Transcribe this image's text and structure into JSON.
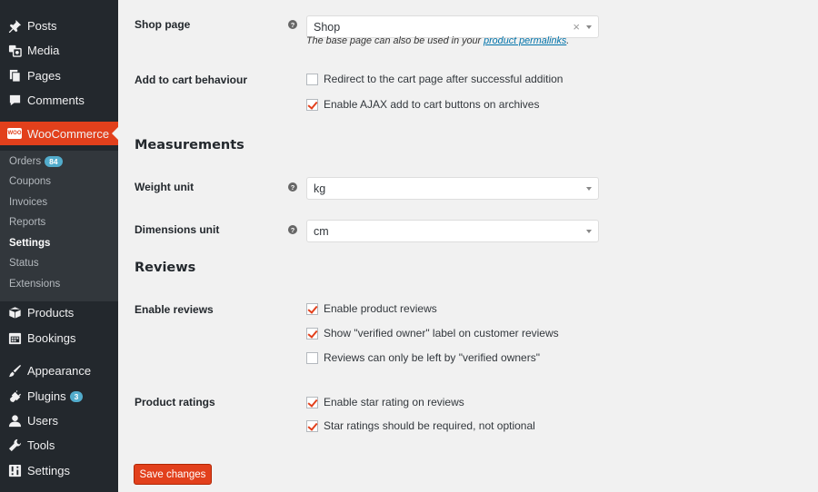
{
  "sidebar": {
    "items": [
      {
        "label": "Posts",
        "icon": "pin-icon"
      },
      {
        "label": "Media",
        "icon": "media-icon"
      },
      {
        "label": "Pages",
        "icon": "pages-icon"
      },
      {
        "label": "Comments",
        "icon": "comments-icon"
      },
      {
        "label": "WooCommerce",
        "icon": "woo-icon"
      },
      {
        "label": "Products",
        "icon": "box-icon"
      },
      {
        "label": "Bookings",
        "icon": "calendar-icon"
      },
      {
        "label": "Appearance",
        "icon": "brush-icon"
      },
      {
        "label": "Plugins",
        "icon": "plugin-icon",
        "badge": "3"
      },
      {
        "label": "Users",
        "icon": "user-icon"
      },
      {
        "label": "Tools",
        "icon": "wrench-icon"
      },
      {
        "label": "Settings",
        "icon": "settings-icon"
      }
    ],
    "woo_logo_text": "WOO",
    "submenu": [
      {
        "label": "Orders",
        "badge": "84"
      },
      {
        "label": "Coupons"
      },
      {
        "label": "Invoices"
      },
      {
        "label": "Reports"
      },
      {
        "label": "Settings",
        "current": true
      },
      {
        "label": "Status"
      },
      {
        "label": "Extensions"
      }
    ]
  },
  "main": {
    "shop_page": {
      "label": "Shop page",
      "value": "Shop",
      "clear": "×",
      "desc_prefix": "The base page can also be used in your ",
      "desc_link": "product permalinks",
      "desc_suffix": "."
    },
    "add_to_cart": {
      "label": "Add to cart behaviour",
      "options": [
        {
          "label": "Redirect to the cart page after successful addition",
          "checked": false
        },
        {
          "label": "Enable AJAX add to cart buttons on archives",
          "checked": true
        }
      ]
    },
    "measurements_title": "Measurements",
    "weight_unit": {
      "label": "Weight unit",
      "value": "kg"
    },
    "dimensions_unit": {
      "label": "Dimensions unit",
      "value": "cm"
    },
    "reviews_title": "Reviews",
    "enable_reviews": {
      "label": "Enable reviews",
      "options": [
        {
          "label": "Enable product reviews",
          "checked": true
        },
        {
          "label": "Show \"verified owner\" label on customer reviews",
          "checked": true
        },
        {
          "label": "Reviews can only be left by \"verified owners\"",
          "checked": false
        }
      ]
    },
    "product_ratings": {
      "label": "Product ratings",
      "options": [
        {
          "label": "Enable star rating on reviews",
          "checked": true
        },
        {
          "label": "Star ratings should be required, not optional",
          "checked": true
        }
      ]
    },
    "help_tip": "?",
    "save_label": "Save changes"
  },
  "colors": {
    "sidebar_bg": "#23282d",
    "submenu_bg": "#32373c",
    "accent": "#e2401c",
    "badge": "#52accc",
    "link": "#0073aa"
  }
}
